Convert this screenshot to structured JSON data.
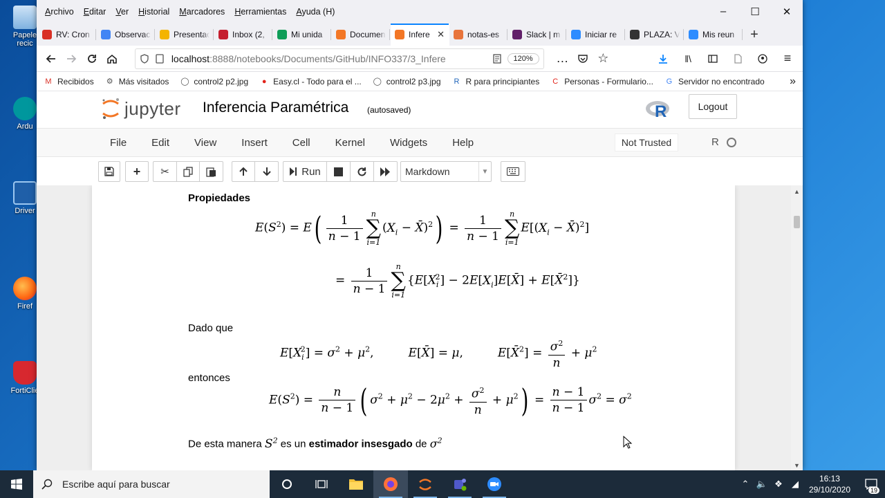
{
  "desktop": {
    "icons": [
      {
        "label": "Papelera de reciclaje",
        "short": "Papele\nrecic"
      },
      {
        "label": "Arduino",
        "short": "Ardu"
      },
      {
        "label": "Driver",
        "short": "Driver"
      },
      {
        "label": "Firefox",
        "short": "Firef"
      },
      {
        "label": "FortiClient",
        "short": "FortiClie"
      }
    ]
  },
  "browser": {
    "menu": [
      "Archivo",
      "Editar",
      "Ver",
      "Historial",
      "Marcadores",
      "Herramientas",
      "Ayuda (H)"
    ],
    "tabs": [
      {
        "title": "RV: Cron",
        "color": "#d93025",
        "icon": "gmail-icon"
      },
      {
        "title": "Observac",
        "color": "#4285f4",
        "icon": "docs-icon"
      },
      {
        "title": "Presentac",
        "color": "#f4b400",
        "icon": "slides-icon"
      },
      {
        "title": "Inbox (2,",
        "color": "#c51f2f",
        "icon": "mail-icon"
      },
      {
        "title": "Mi unida",
        "color": "#0f9d58",
        "icon": "drive-icon"
      },
      {
        "title": "Documen",
        "color": "#f37726",
        "icon": "jupyter-icon"
      },
      {
        "title": "Infere",
        "color": "#f37726",
        "icon": "jupyter-icon",
        "active": true
      },
      {
        "title": "notas-es",
        "color": "#e8743b",
        "icon": "notebook-icon"
      },
      {
        "title": "Slack | m",
        "color": "#611f69",
        "icon": "slack-icon"
      },
      {
        "title": "Iniciar re",
        "color": "#2d8cff",
        "icon": "zoom-icon"
      },
      {
        "title": "PLAZA: V",
        "color": "#333333",
        "icon": "plaza-icon"
      },
      {
        "title": "Mis reun",
        "color": "#2d8cff",
        "icon": "zoom-icon"
      }
    ],
    "url_host": "localhost",
    "url_path": ":8888/notebooks/Documents/GitHub/INFO337/3_Infere",
    "zoom": "120%",
    "bookmarks": [
      {
        "label": "Recibidos",
        "icon": "gmail-icon",
        "color": "#d93025",
        "glyph": "M"
      },
      {
        "label": "Más visitados",
        "icon": "gear-icon",
        "color": "#555555",
        "glyph": "⚙"
      },
      {
        "label": "control2 p2.jpg",
        "icon": "globe-icon",
        "color": "#555555",
        "glyph": "◯"
      },
      {
        "label": "Easy.cl - Todo para el ...",
        "icon": "easy-icon",
        "color": "#e2231a",
        "glyph": "●"
      },
      {
        "label": "control2 p3.jpg",
        "icon": "globe-icon",
        "color": "#555555",
        "glyph": "◯"
      },
      {
        "label": "R para principiantes",
        "icon": "r-icon",
        "color": "#2266bb",
        "glyph": "R"
      },
      {
        "label": "Personas - Formulario...",
        "icon": "personas-icon",
        "color": "#e2231a",
        "glyph": "C"
      },
      {
        "label": "Servidor no encontrado",
        "icon": "google-icon",
        "color": "#4285f4",
        "glyph": "G"
      }
    ]
  },
  "jupyter": {
    "brand": "jupyter",
    "notebook_title": "Inferencia Paramétrica",
    "save_status": "(autosaved)",
    "logout_label": "Logout",
    "menu": [
      "File",
      "Edit",
      "View",
      "Insert",
      "Cell",
      "Kernel",
      "Widgets",
      "Help"
    ],
    "trusted": "Not Trusted",
    "kernel_name": "R",
    "run_label": "Run",
    "cell_type": "Markdown"
  },
  "notebook": {
    "heading": "Propiedades",
    "dado_que": "Dado que",
    "entonces": "entonces",
    "conclusion_a": "De esta manera",
    "conclusion_b": "es un",
    "conclusion_bold": "estimador insesgado",
    "conclusion_c": "de"
  },
  "taskbar": {
    "search_placeholder": "Escribe aquí para buscar",
    "time": "16:13",
    "date": "29/10/2020",
    "notifications": "19"
  },
  "colors": {
    "accent": "#0a84ff",
    "jupyter_orange": "#f37726",
    "taskbar": "#1c2b3a"
  }
}
